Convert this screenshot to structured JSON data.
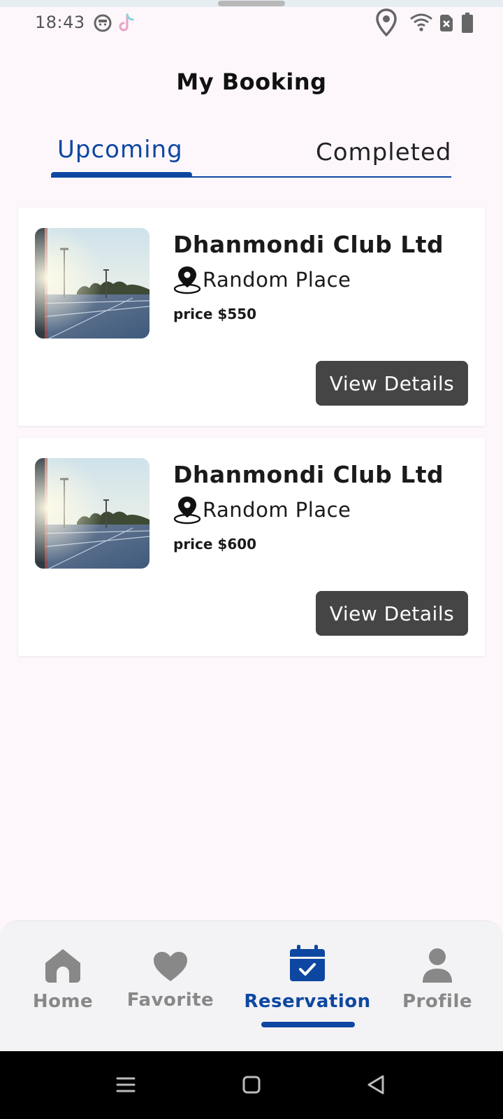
{
  "status_bar": {
    "time": "18:43",
    "icons": [
      "face-icon",
      "tiktok-icon",
      "location-icon",
      "wifi-icon",
      "sim-off-icon",
      "battery-icon"
    ]
  },
  "header": {
    "title": "My Booking"
  },
  "tabs": [
    {
      "label": "Upcoming",
      "active": true
    },
    {
      "label": "Completed",
      "active": false
    }
  ],
  "bookings": [
    {
      "name": "Dhanmondi Club Ltd",
      "location": "Random Place",
      "price": "price $550",
      "button_label": "View Details",
      "image": "tennis-court-photo"
    },
    {
      "name": "Dhanmondi Club Ltd",
      "location": "Random Place",
      "price": "price $600",
      "button_label": "View Details",
      "image": "tennis-court-photo"
    }
  ],
  "bottom_nav": {
    "items": [
      {
        "label": "Home",
        "icon": "home-icon",
        "active": false
      },
      {
        "label": "Favorite",
        "icon": "heart-icon",
        "active": false
      },
      {
        "label": "Reservation",
        "icon": "calendar-check-icon",
        "active": true
      },
      {
        "label": "Profile",
        "icon": "person-icon",
        "active": false
      }
    ]
  },
  "system_nav": [
    "menu-icon",
    "home-square-icon",
    "back-triangle-icon"
  ],
  "colors": {
    "accent": "#0d47a1",
    "background": "#fdf7fb",
    "button": "#454545",
    "nav_inactive": "#888888"
  }
}
